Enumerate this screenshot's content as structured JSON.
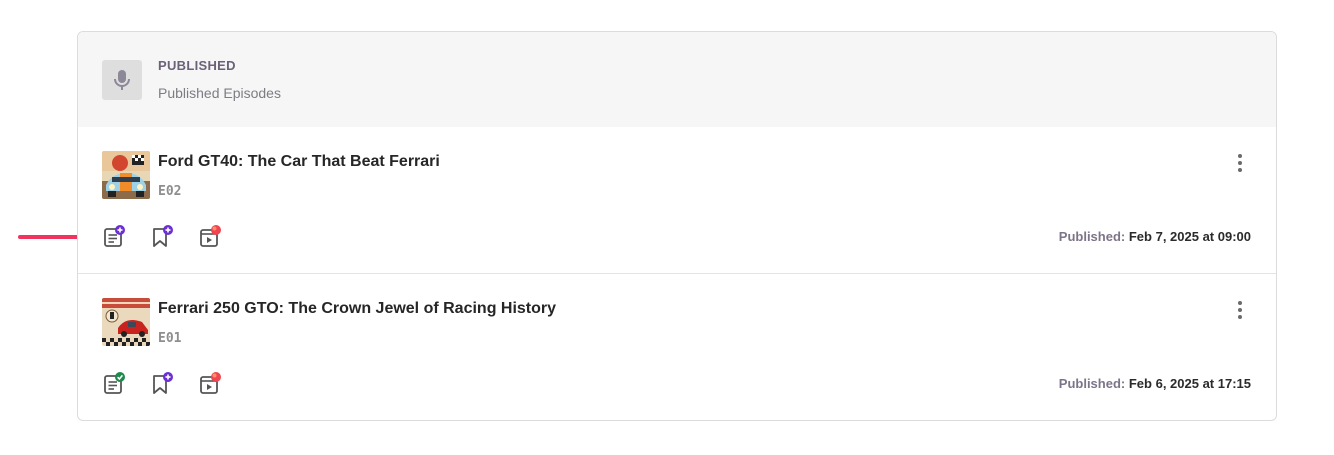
{
  "header": {
    "title": "PUBLISHED",
    "subtitle": "Published Episodes",
    "icon": "microphone-icon"
  },
  "episodes": [
    {
      "title": "Ford GT40: The Car That Beat Ferrari",
      "code": "E02",
      "published_label": "Published:",
      "published_date": "Feb 7, 2025 at 09:00",
      "actions": [
        "add-transcript-icon",
        "add-chapter-bookmark-icon",
        "video-icon"
      ],
      "transcript_status": "add"
    },
    {
      "title": "Ferrari 250 GTO: The Crown Jewel of Racing History",
      "code": "E01",
      "published_label": "Published:",
      "published_date": "Feb 6, 2025 at 17:15",
      "actions": [
        "transcript-done-icon",
        "add-chapter-bookmark-icon",
        "video-icon"
      ],
      "transcript_status": "done"
    }
  ],
  "colors": {
    "accent_purple": "#6b2fd6",
    "success_green": "#1f8a4c",
    "recording_red": "#f0444f",
    "annotation_arrow": "#f0345d"
  }
}
